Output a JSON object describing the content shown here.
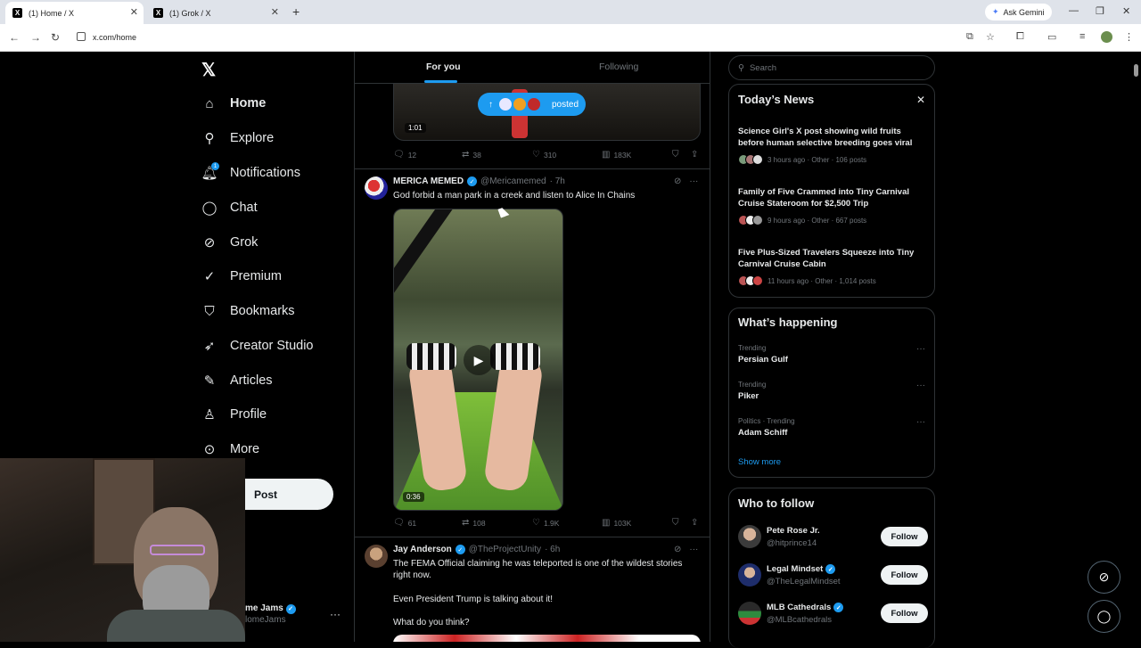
{
  "browser": {
    "tabs": [
      {
        "label": "(1) Home / X",
        "active": true
      },
      {
        "label": "(1) Grok / X",
        "active": false
      }
    ],
    "new_tab_icon": "plus-icon",
    "ask_gemini": "Ask Gemini",
    "url": "x.com/home"
  },
  "nav": {
    "logo": "𝕏",
    "items": [
      {
        "label": "Home",
        "icon": "home-icon"
      },
      {
        "label": "Explore",
        "icon": "search-icon"
      },
      {
        "label": "Notifications",
        "icon": "bell-icon",
        "badge": "1"
      },
      {
        "label": "Chat",
        "icon": "chat-icon"
      },
      {
        "label": "Grok",
        "icon": "grok-icon"
      },
      {
        "label": "Premium",
        "icon": "premium-icon"
      },
      {
        "label": "Bookmarks",
        "icon": "bookmark-icon"
      },
      {
        "label": "Creator Studio",
        "icon": "rocket-icon"
      },
      {
        "label": "Articles",
        "icon": "article-icon"
      },
      {
        "label": "Profile",
        "icon": "person-icon"
      },
      {
        "label": "More",
        "icon": "more-circle-icon"
      }
    ],
    "post_button": "Post",
    "account": {
      "name": "me Jams",
      "handle": "lomeJams"
    }
  },
  "timeline": {
    "tabs": [
      "For you",
      "Following"
    ],
    "active_tab": "For you",
    "posted_pill": "posted",
    "prev_post": {
      "duration": "1:01",
      "replies": "12",
      "reposts": "38",
      "likes": "310",
      "views": "183K"
    },
    "post1": {
      "name": "MERICA MEMED",
      "handle": "@Mericamemed",
      "time": "· 7h",
      "text": "God forbid a man park in a creek and listen to Alice In Chains",
      "duration": "0:36",
      "replies": "61",
      "reposts": "108",
      "likes": "1.9K",
      "views": "103K"
    },
    "post2": {
      "name": "Jay Anderson",
      "handle": "@TheProjectUnity",
      "time": "· 6h",
      "line1": "The FEMA Official claiming he was teleported is one of the wildest stories right now.",
      "line2": "Even President Trump is talking about it!",
      "line3": "What do you think?"
    }
  },
  "sidebar": {
    "search_placeholder": "Search",
    "news": {
      "title": "Today’s News",
      "items": [
        {
          "title": "Science Girl's X post showing wild fruits before human selective breeding goes viral",
          "meta": "3 hours ago · Other · 106 posts"
        },
        {
          "title": "Family of Five Crammed into Tiny Carnival Cruise Stateroom for $2,500 Trip",
          "meta": "9 hours ago · Other · 667 posts"
        },
        {
          "title": "Five Plus-Sized Travelers Squeeze into Tiny Carnival Cruise Cabin",
          "meta": "11 hours ago · Other · 1,014 posts"
        }
      ]
    },
    "happening": {
      "title": "What’s happening",
      "trends": [
        {
          "category": "Trending",
          "name": "Persian Gulf"
        },
        {
          "category": "Trending",
          "name": "Piker"
        },
        {
          "category": "Politics · Trending",
          "name": "Adam Schiff"
        }
      ],
      "show_more": "Show more"
    },
    "who_to_follow": {
      "title": "Who to follow",
      "follow_label": "Follow",
      "accounts": [
        {
          "name": "Pete Rose Jr.",
          "handle": "@hitprince14",
          "verified": false
        },
        {
          "name": "Legal Mindset",
          "handle": "@TheLegalMindset",
          "verified": true
        },
        {
          "name": "MLB Cathedrals",
          "handle": "@MLBcathedrals",
          "verified": true
        }
      ]
    }
  },
  "colors": {
    "accent": "#1d9bf0",
    "background": "#000000",
    "border": "#2f3336",
    "muted": "#71767b"
  }
}
